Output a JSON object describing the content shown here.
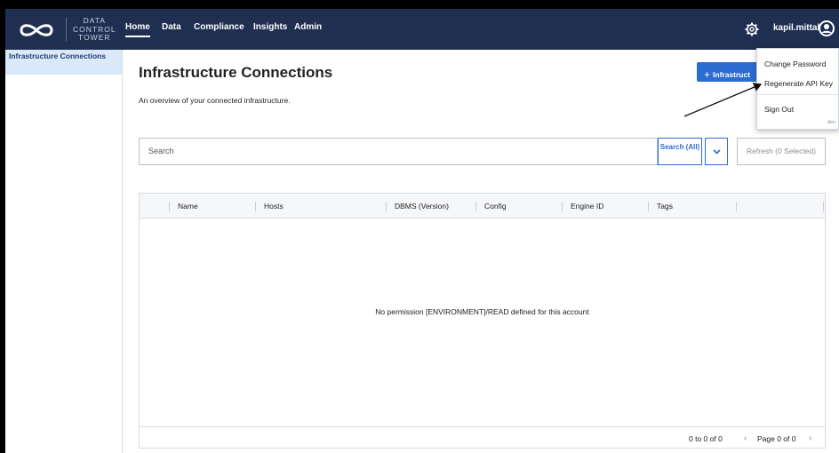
{
  "app": {
    "logo_lines": [
      "DATA",
      "CONTROL",
      "TOWER"
    ]
  },
  "nav": {
    "items": [
      "Home",
      "Data",
      "Compliance",
      "Insights",
      "Admin"
    ],
    "active": "Home"
  },
  "header": {
    "username": "kapil.mittal"
  },
  "sidebar": {
    "items": [
      {
        "label": "Infrastructure Connections",
        "selected": true
      }
    ]
  },
  "main": {
    "title": "Infrastructure Connections",
    "subtitle": "An overview of your connected infrastructure.",
    "add_button": "Infrastruct"
  },
  "search": {
    "placeholder": "Search",
    "scope_button": "Search (All)",
    "refresh_button": "Refresh (0 Selected)"
  },
  "table": {
    "columns": [
      "Name",
      "Hosts",
      "DBMS (Version)",
      "Config",
      "Engine ID",
      "Tags"
    ],
    "empty_message": "No permission [ENVIRONMENT]/READ defined for this account",
    "rows_count": "0 to 0 of 0",
    "page_info": "Page 0 of 0"
  },
  "user_menu": {
    "items": [
      "Change Password",
      "Regenerate API Key",
      "Sign Out"
    ],
    "environment": "dev"
  },
  "colors": {
    "topbar": "#1e2f52",
    "accent": "#2b6dd1",
    "sidebar_selected": "#dbe8f8"
  }
}
